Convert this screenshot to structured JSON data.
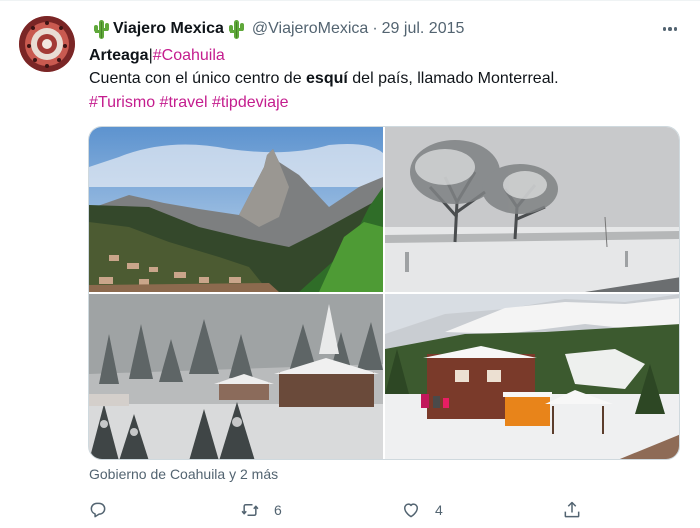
{
  "tweet": {
    "display_name": "Viajero Mexica",
    "handle": "@ViajeroMexica",
    "separator": "·",
    "date": "29 jul. 2015",
    "line1": {
      "bold": "Arteaga",
      "pipe": "|",
      "hashtag": "#Coahuila"
    },
    "line2": {
      "before": "Cuenta con el único centro de ",
      "bold": "esquí",
      "after": " del país, llamado Monterreal."
    },
    "hashtags": [
      "#Turismo",
      "#travel",
      "#tipdeviaje"
    ],
    "tagged_people": "Gobierno de Coahuila y 2 más",
    "retweets": "6",
    "likes": "4"
  },
  "icons": {
    "more": "more-horizontal-icon",
    "reply": "reply-icon",
    "retweet": "retweet-icon",
    "like": "heart-icon",
    "share": "share-icon",
    "name_emoji": "cactus-icon"
  },
  "colors": {
    "hashtag": "#c41d8e",
    "secondary_text": "#536471",
    "primary_text": "#0f1419",
    "border": "#cfd9de"
  }
}
